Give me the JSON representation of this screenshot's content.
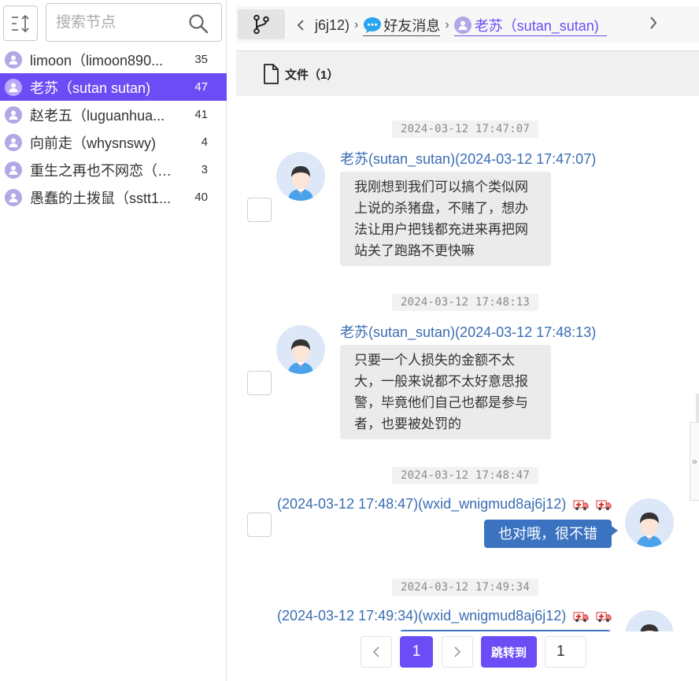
{
  "sidebar": {
    "search_placeholder": "搜索节点",
    "nodes": [
      {
        "name": "limoon（limoon890...",
        "count": "35"
      },
      {
        "name": "老苏（sutan sutan)",
        "count": "47"
      },
      {
        "name": "赵老五（luguanhua...",
        "count": "41"
      },
      {
        "name": "向前走（whysnswy)",
        "count": "4"
      },
      {
        "name": "重生之再也不网恋（Fil...",
        "count": "3"
      },
      {
        "name": "愚蠢的土拨鼠（sstt1...",
        "count": "40"
      }
    ]
  },
  "breadcrumb": {
    "part1": "j6j12)",
    "part2": "好友消息",
    "part3": "老苏（sutan_sutan)"
  },
  "tabs": {
    "file_tab": "文件（1）"
  },
  "messages": [
    {
      "time": "2024-03-12 17:47:07",
      "sender": "老苏(sutan_sutan)(2024-03-12 17:47:07)",
      "lines": [
        "我刚想到我们可以搞个类似网",
        "上说的杀猪盘，不赌了，想办",
        "法让用户把钱都充进来再把网",
        "站关了跑路不更快嘛"
      ]
    },
    {
      "time": "2024-03-12 17:48:13",
      "sender": "老苏(sutan_sutan)(2024-03-12 17:48:13)",
      "lines": [
        "只要一个人损失的金额不太",
        "大，一般来说都不太好意思报",
        "警，毕竟他们自己也都是参与",
        "者，也要被处罚的"
      ]
    },
    {
      "time": "2024-03-12 17:48:47",
      "sender": "(2024-03-12 17:48:47)(wxid_wnigmud8aj6j12)",
      "text": "也对哦，很不错"
    },
    {
      "time": "2024-03-12 17:49:34",
      "sender": "(2024-03-12 17:49:34)(wxid_wnigmud8aj6j12)"
    }
  ],
  "pager": {
    "current": "1",
    "jump_label": "跳转到",
    "jump_value": "1"
  },
  "colors": {
    "accent": "#6c4df5",
    "sender_blue": "#3a6db3",
    "out_bubble": "#3b73c0"
  }
}
